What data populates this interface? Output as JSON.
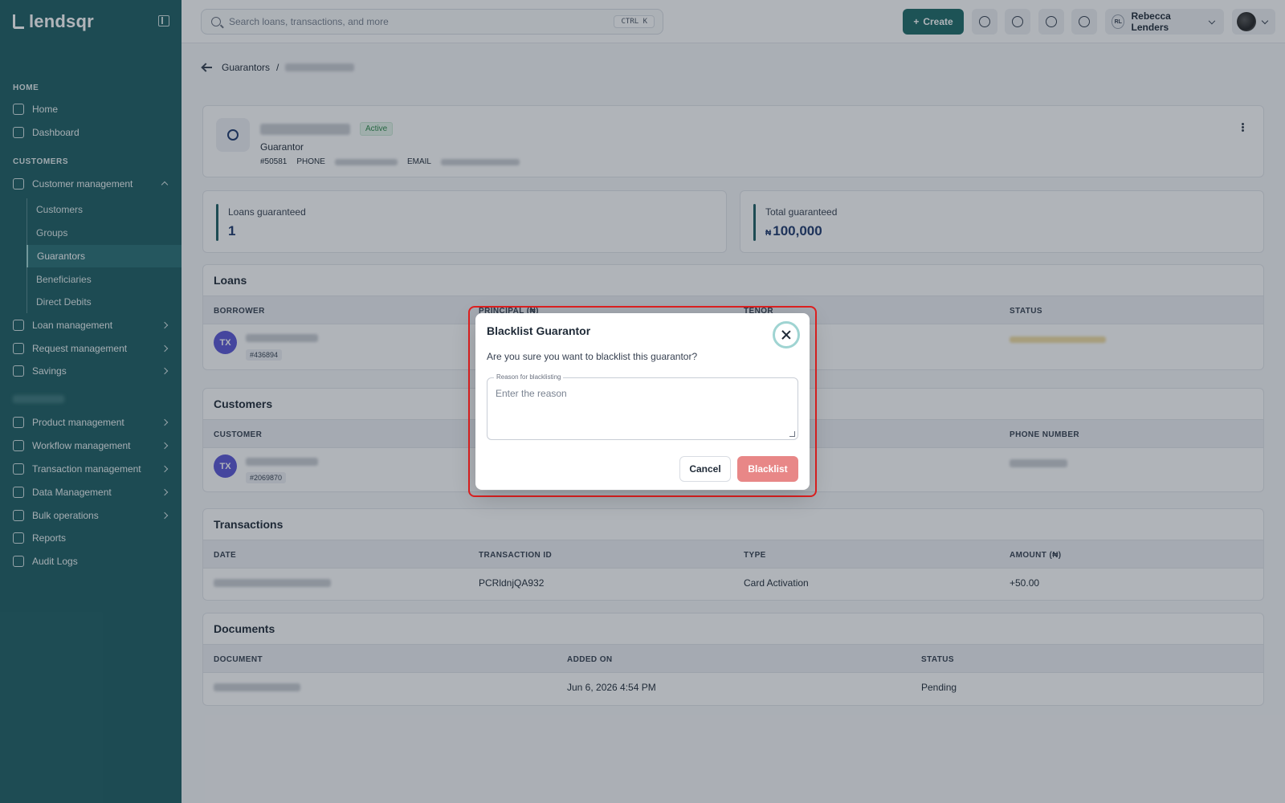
{
  "app": {
    "logo_text": "lendsqr"
  },
  "sidebar": {
    "sections": {
      "home": "HOME",
      "customers": "CUSTOMERS"
    },
    "items": {
      "home": "Home",
      "dashboard": "Dashboard",
      "customer_management": "Customer management",
      "loan_management": "Loan management",
      "request_management": "Request management",
      "savings": "Savings",
      "product_management": "Product management",
      "workflow_management": "Workflow management",
      "transaction_management": "Transaction management",
      "data_management": "Data Management",
      "bulk_operations": "Bulk operations",
      "reports": "Reports",
      "audit_logs": "Audit Logs"
    },
    "sub_items": {
      "customers": "Customers",
      "groups": "Groups",
      "guarantors": "Guarantors",
      "beneficiaries": "Beneficiaries",
      "direct_debits": "Direct Debits"
    },
    "active_sub_item": "Guarantors"
  },
  "topbar": {
    "search_placeholder": "Search loans, transactions, and more",
    "search_shortcut": "CTRL K",
    "create_label": "Create",
    "user_initials": "RL",
    "user_name": "Rebecca Lenders"
  },
  "breadcrumb": {
    "parent": "Guarantors",
    "separator": "/"
  },
  "profile": {
    "status": "Active",
    "role": "Guarantor",
    "id": "#50581",
    "phone_label": "PHONE",
    "email_label": "EMAIL"
  },
  "stats": {
    "loans_guaranteed_label": "Loans guaranteed",
    "loans_guaranteed_value": "1",
    "total_guaranteed_label": "Total guaranteed",
    "total_guaranteed_currency": "₦",
    "total_guaranteed_value": "100,000"
  },
  "loans": {
    "title": "Loans",
    "columns": [
      "BORROWER",
      "PRINCIPAL (₦)",
      "TENOR",
      "STATUS"
    ],
    "rows": [
      {
        "initials": "TX",
        "id": "#436894"
      }
    ]
  },
  "customers": {
    "title": "Customers",
    "columns": [
      "CUSTOMER",
      "PHONE NUMBER"
    ],
    "rows": [
      {
        "initials": "TX",
        "id": "#2069870"
      }
    ]
  },
  "transactions": {
    "title": "Transactions",
    "columns": [
      "DATE",
      "TRANSACTION ID",
      "TYPE",
      "AMOUNT (₦)"
    ],
    "rows": [
      {
        "transaction_id": "PCRldnjQA932",
        "type": "Card Activation",
        "amount": "+50.00"
      }
    ]
  },
  "documents": {
    "title": "Documents",
    "columns": [
      "DOCUMENT",
      "ADDED ON",
      "STATUS"
    ],
    "rows": [
      {
        "added_on": "Jun 6, 2026 4:54 PM",
        "status": "Pending"
      }
    ]
  },
  "modal": {
    "title": "Blacklist Guarantor",
    "question": "Are you sure you want to blacklist this guarantor?",
    "reason_label": "Reason for blacklisting",
    "reason_placeholder": "Enter the reason",
    "reason_value": "",
    "cancel_label": "Cancel",
    "confirm_label": "Blacklist"
  },
  "colors": {
    "sidebar_bg": "#1e5f63",
    "accent": "#1e6b68",
    "avatar": "#5b56d6",
    "danger_button": "#e88787",
    "highlight": "#e02020"
  }
}
